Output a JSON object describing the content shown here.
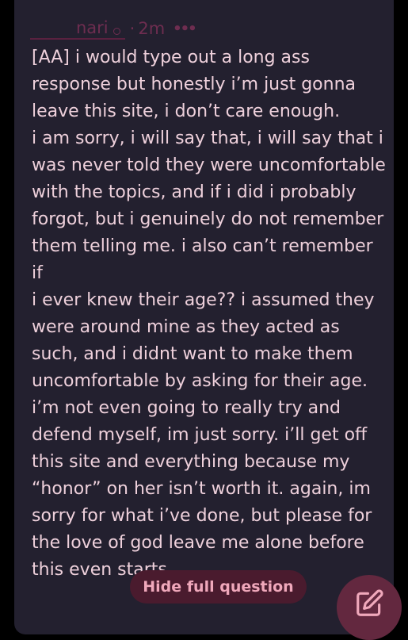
{
  "post": {
    "author": "nari",
    "separator": "·",
    "time": "2m",
    "more_icon": "•••",
    "body_lines": [
      "[AA] i would type out a long ass",
      "response but honestly i’m just gonna",
      "leave this site, i don’t care enough.",
      "i am sorry, i will say that, i will say that i",
      "was never told they were uncomfortable",
      "with the topics, and if i did i probably",
      "forgot, but i genuinely do not remember",
      "them telling me. i also can’t remember if",
      "i ever knew their age?? i assumed they",
      "were around mine as they acted as",
      "such, and i didnt want to make them",
      "uncomfortable by asking for their age.",
      "i’m not even going to really try and",
      "defend myself, im just sorry. i’ll get off",
      "this site and everything because my",
      "“honor” on her isn’t worth it. again, im",
      "sorry for what i’ve done, but please for",
      "the love of god leave me alone before",
      "this even starts"
    ]
  },
  "actions": {
    "hide_label": "Hide full question",
    "compose_icon": "edit-icon"
  },
  "colors": {
    "card_bg": "#23202f",
    "text": "#eed0db",
    "accent": "#f0a8bb",
    "muted": "#6e2d50",
    "fab_bg": "#63283f"
  }
}
